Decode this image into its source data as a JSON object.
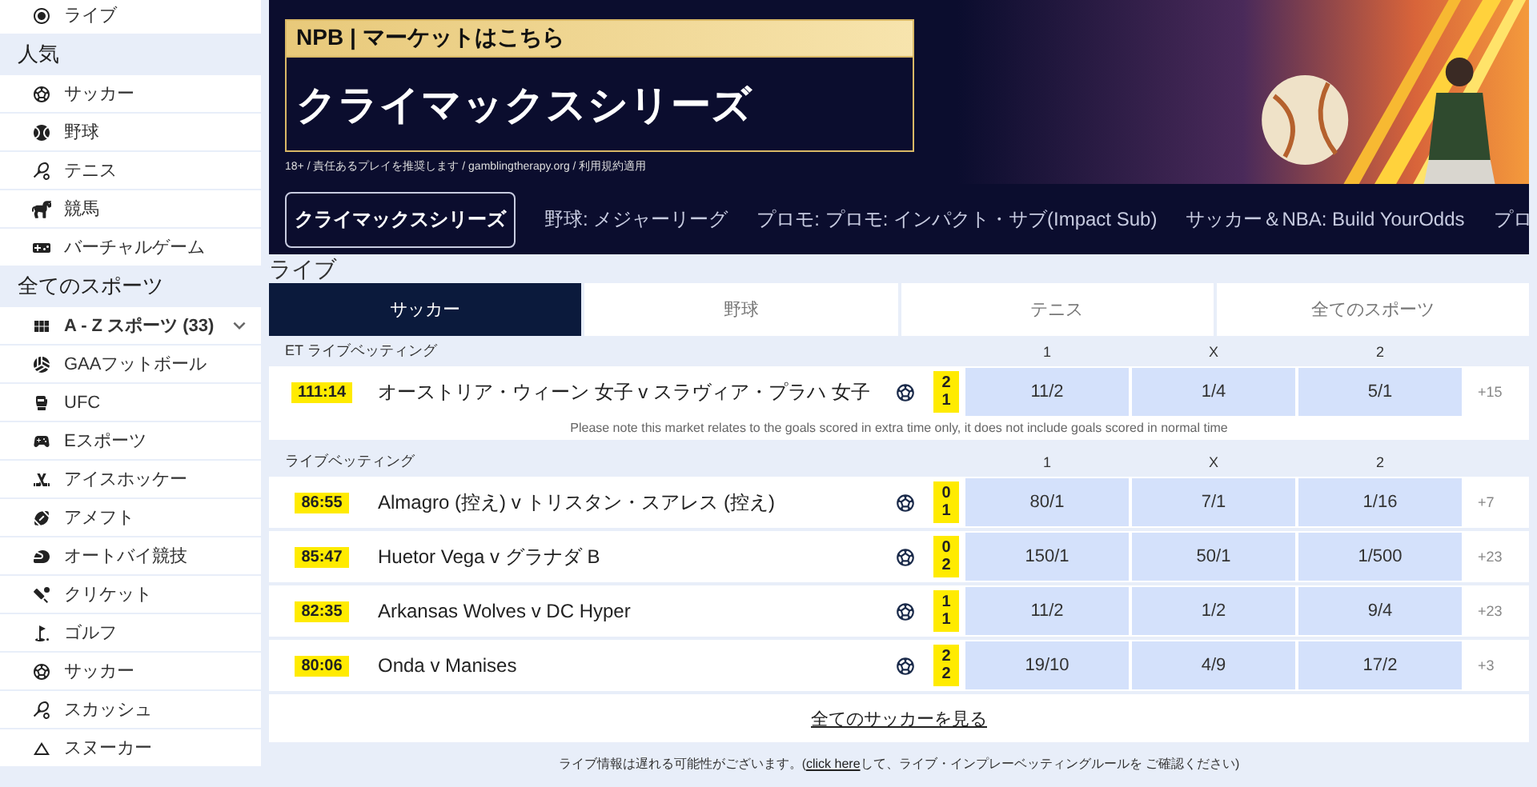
{
  "sidebar": {
    "top_items": [
      {
        "label": "ライブ"
      }
    ],
    "groups": [
      {
        "title": "人気",
        "items": [
          {
            "label": "サッカー",
            "kind": "link"
          },
          {
            "label": "野球",
            "kind": "link"
          },
          {
            "label": "テニス",
            "kind": "link"
          },
          {
            "label": "競馬",
            "kind": "link"
          },
          {
            "label": "バーチャルゲーム",
            "kind": "link"
          }
        ]
      },
      {
        "title": "全てのスポーツ",
        "items": [
          {
            "label": "A - Z スポーツ (33)",
            "kind": "dropdown"
          },
          {
            "label": "GAAフットボール",
            "kind": "link"
          },
          {
            "label": "UFC",
            "kind": "link"
          },
          {
            "label": "Eスポーツ",
            "kind": "link"
          },
          {
            "label": "アイスホッケー",
            "kind": "link"
          },
          {
            "label": "アメフト",
            "kind": "link"
          },
          {
            "label": "オートバイ競技",
            "kind": "link"
          },
          {
            "label": "クリケット",
            "kind": "link"
          },
          {
            "label": "ゴルフ",
            "kind": "link"
          },
          {
            "label": "サッカー",
            "kind": "link"
          },
          {
            "label": "スカッシュ",
            "kind": "link"
          },
          {
            "label": "スヌーカー",
            "kind": "link"
          }
        ]
      }
    ]
  },
  "banner": {
    "eyebrow": "NPB | マーケットはこちら",
    "title": "クライマックスシリーズ",
    "disclaimer": "18+ / 責任あるプレイを推奨します / gamblingtherapy.org / 利用規約適用"
  },
  "promo_nav": [
    {
      "label": "クライマックスシリーズ",
      "selected": true
    },
    {
      "label": "野球: メジャーリーグ",
      "selected": false
    },
    {
      "label": "プロモ: プロモ: インパクト・サブ(Impact Sub)",
      "selected": false
    },
    {
      "label": "サッカー＆NBA: Build YourOdds",
      "selected": false
    },
    {
      "label": "プロ",
      "selected": false
    }
  ],
  "live": {
    "title": "ライブ",
    "tabs": [
      {
        "label": "サッカー",
        "selected": true
      },
      {
        "label": "野球",
        "selected": false
      },
      {
        "label": "テニス",
        "selected": false
      },
      {
        "label": "全てのスポーツ",
        "selected": false
      }
    ],
    "sections": [
      {
        "title": "ET ライブベッティング",
        "columns": [
          "1",
          "X",
          "2"
        ],
        "rows": [
          {
            "time": "111:14",
            "match": "オーストリア・ウィーン 女子 v スラヴィア・プラハ 女子",
            "score": [
              "2",
              "1"
            ],
            "odds": [
              "11/2",
              "1/4",
              "5/1"
            ],
            "more": "+15"
          }
        ],
        "note": "Please note this market relates to the goals scored in extra time only, it does not include goals scored in normal time"
      },
      {
        "title": "ライブベッティング",
        "columns": [
          "1",
          "X",
          "2"
        ],
        "rows": [
          {
            "time": "86:55",
            "match": "Almagro (控え) v トリスタン・スアレス (控え)",
            "score": [
              "0",
              "1"
            ],
            "odds": [
              "80/1",
              "7/1",
              "1/16"
            ],
            "more": "+7"
          },
          {
            "time": "85:47",
            "match": "Huetor Vega v グラナダ B",
            "score": [
              "0",
              "2"
            ],
            "odds": [
              "150/1",
              "50/1",
              "1/500"
            ],
            "more": "+23"
          },
          {
            "time": "82:35",
            "match": "Arkansas Wolves v DC Hyper",
            "score": [
              "1",
              "1"
            ],
            "odds": [
              "11/2",
              "1/2",
              "9/4"
            ],
            "more": "+23"
          },
          {
            "time": "80:06",
            "match": "Onda v Manises",
            "score": [
              "2",
              "2"
            ],
            "odds": [
              "19/10",
              "4/9",
              "17/2"
            ],
            "more": "+3"
          }
        ]
      }
    ],
    "see_all": "全てのサッカーを見る"
  },
  "footer": {
    "before": "ライブ情報は遅れる可能性がございます。(",
    "link": "click here",
    "after": "して、ライブ・インプレーベッティングルールを ご確認ください)"
  }
}
